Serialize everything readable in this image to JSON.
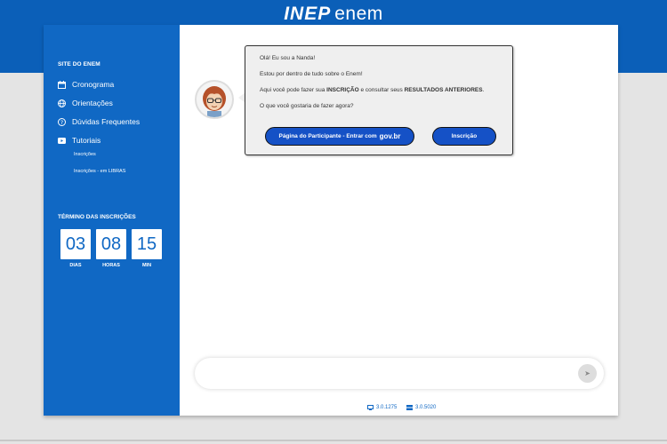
{
  "header": {
    "logo_inep": "INEP",
    "logo_enem": "enem"
  },
  "sidebar": {
    "title": "SITE DO ENEM",
    "items": [
      {
        "label": "Cronograma",
        "icon": "calendar-icon"
      },
      {
        "label": "Orientações",
        "icon": "globe-icon"
      },
      {
        "label": "Dúvidas Frequentes",
        "icon": "question-icon"
      },
      {
        "label": "Tutoriais",
        "icon": "youtube-icon"
      }
    ],
    "subitems": [
      "Inscrições",
      "Inscrições - em LIBRAS"
    ],
    "countdown": {
      "title": "TÉRMINO DAS INSCRIÇÕES",
      "days": "03",
      "days_label": "DIAS",
      "hours": "08",
      "hours_label": "HORAS",
      "minutes": "15",
      "minutes_label": "MIN"
    }
  },
  "chat": {
    "line1": "Olá! Eu sou a Nanda!",
    "line2": "Estou por dentro de tudo sobre o Enem!",
    "line3_pre": "Aqui você pode fazer sua ",
    "line3_b1": "INSCRIÇÃO",
    "line3_mid": " e consultar seus ",
    "line3_b2": "RESULTADOS ANTERIORES",
    "line3_post": ".",
    "line4": "O que você gostaria de fazer agora?",
    "btn_participante": "Página do Participante - Entrar com",
    "btn_participante_gov": "gov.br",
    "btn_inscricao": "Inscrição"
  },
  "input": {
    "placeholder": "",
    "send_icon": "send-icon"
  },
  "footer": {
    "version1": "3.0.1275",
    "version2": "3.0.5020"
  },
  "colors": {
    "primary": "#1068c4",
    "button": "#1551c6",
    "header": "#0b5fb8"
  }
}
